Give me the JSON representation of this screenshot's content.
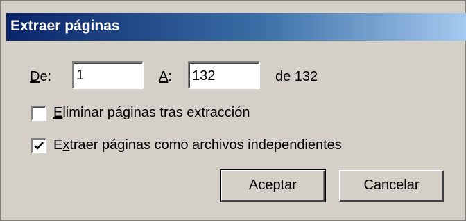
{
  "dialog": {
    "title": "Extraer páginas"
  },
  "range": {
    "from_label_key": "D",
    "from_label_rest": "e:",
    "from_value": "1",
    "to_label_key": "A",
    "to_label_rest": ":",
    "to_value": "132",
    "total_text": "de 132"
  },
  "options": {
    "delete_pages": {
      "label_key": "E",
      "label_rest": "liminar páginas tras extracción",
      "checked": false
    },
    "separate_files": {
      "label_pre": "E",
      "label_key": "x",
      "label_rest": "traer páginas como archivos independientes",
      "checked": true
    }
  },
  "buttons": {
    "ok_label": "Aceptar",
    "cancel_label": "Cancelar"
  }
}
